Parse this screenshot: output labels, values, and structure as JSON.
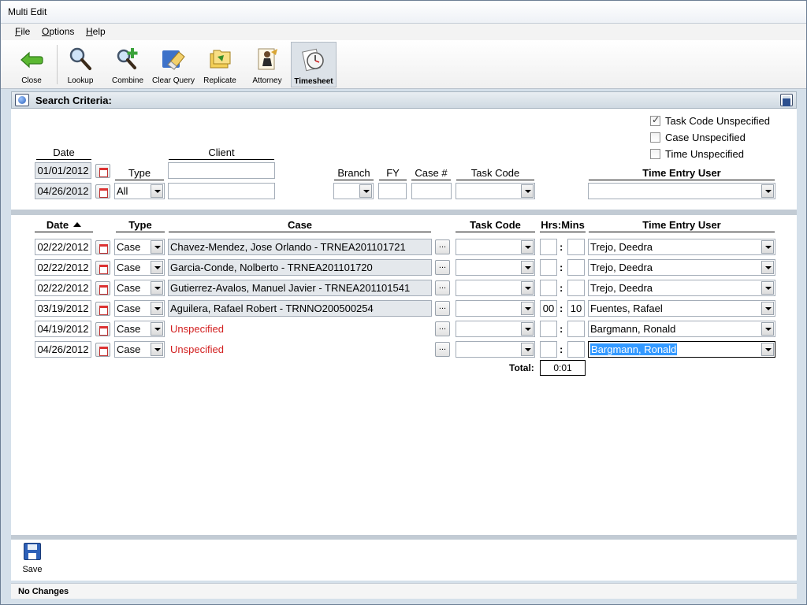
{
  "window": {
    "title": "Multi Edit"
  },
  "menu": [
    {
      "label": "File",
      "accel": "F",
      "rest": "ile"
    },
    {
      "label": "Options",
      "accel": "O",
      "rest": "ptions"
    },
    {
      "label": "Help",
      "accel": "H",
      "rest": "elp"
    }
  ],
  "toolbar": {
    "close": "Close",
    "lookup": "Lookup",
    "combine": "Combine",
    "clear_query": "Clear Query",
    "replicate": "Replicate",
    "attorney": "Attorney",
    "timesheet": "Timesheet"
  },
  "criteria": {
    "title": "Search Criteria:",
    "labels": {
      "date": "Date",
      "type": "Type",
      "client": "Client",
      "branch": "Branch",
      "fy": "FY",
      "case_no": "Case #",
      "task_code": "Task Code",
      "time_entry_user": "Time Entry User"
    },
    "date_from": "01/01/2012",
    "date_to": "04/26/2012",
    "type_value": "All",
    "client_value": "",
    "client_value_2": "",
    "branch_value": "",
    "fy_value": "",
    "case_no_value": "",
    "task_code_value": "",
    "time_entry_user_value": "",
    "checkboxes": [
      {
        "label": "Task Code Unspecified",
        "checked": true
      },
      {
        "label": "Case Unspecified",
        "checked": false
      },
      {
        "label": "Time Unspecified",
        "checked": false
      }
    ]
  },
  "grid": {
    "headers": {
      "date": "Date",
      "type": "Type",
      "case": "Case",
      "task_code": "Task Code",
      "hrs_mins": "Hrs:Mins",
      "time_entry_user": "Time Entry User"
    },
    "rows": [
      {
        "date": "02/22/2012",
        "type": "Case",
        "case": "Chavez-Mendez, Jose Orlando - TRNEA201101721",
        "task_code": "",
        "hrs": "",
        "mins": "",
        "user": "Trejo, Deedra"
      },
      {
        "date": "02/22/2012",
        "type": "Case",
        "case": "Garcia-Conde, Nolberto  - TRNEA201101720",
        "task_code": "",
        "hrs": "",
        "mins": "",
        "user": "Trejo, Deedra"
      },
      {
        "date": "02/22/2012",
        "type": "Case",
        "case": "Gutierrez-Avalos, Manuel Javier - TRNEA201101541",
        "task_code": "",
        "hrs": "",
        "mins": "",
        "user": "Trejo, Deedra"
      },
      {
        "date": "03/19/2012",
        "type": "Case",
        "case": "Aguilera, Rafael Robert - TRNNO200500254",
        "task_code": "",
        "hrs": "00",
        "mins": "10",
        "user": "Fuentes, Rafael"
      },
      {
        "date": "04/19/2012",
        "type": "Case",
        "case": "Unspecified",
        "task_code": "",
        "hrs": "",
        "mins": "",
        "user": "Bargmann, Ronald"
      },
      {
        "date": "04/26/2012",
        "type": "Case",
        "case": "Unspecified",
        "task_code": "",
        "hrs": "",
        "mins": "",
        "user": "Bargmann, Ronald"
      }
    ],
    "colon": ":",
    "dots": "...",
    "total_label": "Total:",
    "total_value": "0:01"
  },
  "footer": {
    "save": "Save"
  },
  "status": "No Changes"
}
